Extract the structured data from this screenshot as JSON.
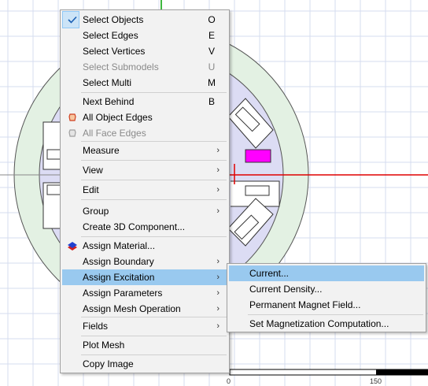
{
  "ruler": {
    "start_label": "0",
    "end_label": "150"
  },
  "context_menu": {
    "items": [
      {
        "label": "Select Objects",
        "shortcut": "O",
        "checked": true
      },
      {
        "label": "Select Edges",
        "shortcut": "E"
      },
      {
        "label": "Select Vertices",
        "shortcut": "V"
      },
      {
        "label": "Select Submodels",
        "shortcut": "U",
        "disabled": true
      },
      {
        "label": "Select Multi",
        "shortcut": "M"
      },
      {
        "label": "Next Behind",
        "shortcut": "B"
      },
      {
        "label": "All Object Edges",
        "icon": "object-edges-icon"
      },
      {
        "label": "All Face Edges",
        "icon": "face-edges-icon",
        "disabled": true
      },
      {
        "label": "Measure",
        "submenu": true
      },
      {
        "label": "View",
        "submenu": true
      },
      {
        "label": "Edit",
        "submenu": true
      },
      {
        "label": "Group",
        "submenu": true
      },
      {
        "label": "Create 3D Component..."
      },
      {
        "label": "Assign Material...",
        "icon": "material-icon"
      },
      {
        "label": "Assign Boundary",
        "submenu": true
      },
      {
        "label": "Assign Excitation",
        "submenu": true,
        "highlighted": true
      },
      {
        "label": "Assign Parameters",
        "submenu": true
      },
      {
        "label": "Assign Mesh Operation",
        "submenu": true
      },
      {
        "label": "Fields",
        "submenu": true
      },
      {
        "label": "Plot Mesh"
      },
      {
        "label": "Copy Image"
      }
    ]
  },
  "excitation_submenu": {
    "items": [
      {
        "label": "Current...",
        "highlighted": true
      },
      {
        "label": "Current Density..."
      },
      {
        "label": "Permanent Magnet Field..."
      },
      {
        "label": "Set Magnetization Computation..."
      }
    ]
  },
  "colors": {
    "menu_bg": "#f2f2f2",
    "highlight": "#99c9ef",
    "grid": "#d6dcef",
    "stator_fill": "#e3f1e3",
    "rotor_fill": "#dcdcf4",
    "magenta_block": "#ff00ff",
    "axis_red": "#e00000"
  }
}
